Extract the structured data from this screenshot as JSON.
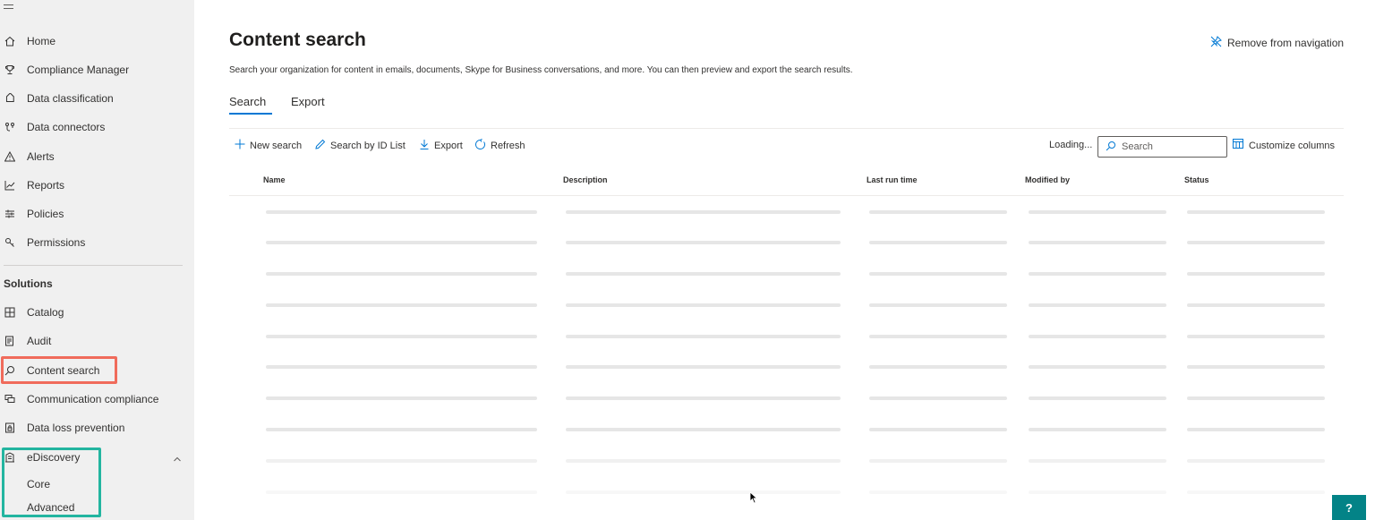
{
  "sidebar": {
    "items": [
      {
        "label": "Home",
        "icon": "home-icon"
      },
      {
        "label": "Compliance Manager",
        "icon": "trophy-icon"
      },
      {
        "label": "Data classification",
        "icon": "tag-icon"
      },
      {
        "label": "Data connectors",
        "icon": "connector-icon"
      },
      {
        "label": "Alerts",
        "icon": "warning-icon"
      },
      {
        "label": "Reports",
        "icon": "chart-icon"
      },
      {
        "label": "Policies",
        "icon": "sliders-icon"
      },
      {
        "label": "Permissions",
        "icon": "key-icon"
      }
    ],
    "section_title": "Solutions",
    "solutions": [
      {
        "label": "Catalog",
        "icon": "catalog-icon"
      },
      {
        "label": "Audit",
        "icon": "audit-icon"
      },
      {
        "label": "Content search",
        "icon": "search-icon"
      },
      {
        "label": "Communication compliance",
        "icon": "chat-icon"
      },
      {
        "label": "Data loss prevention",
        "icon": "lock-doc-icon"
      },
      {
        "label": "eDiscovery",
        "icon": "ediscovery-icon"
      }
    ],
    "ediscovery_sub": [
      "Core",
      "Advanced"
    ]
  },
  "header": {
    "title": "Content search",
    "subtitle": "Search your organization for content in emails, documents, Skype for Business conversations, and more. You can then preview and export the search results.",
    "remove_nav_label": "Remove from navigation"
  },
  "tabs": [
    {
      "label": "Search",
      "active": true
    },
    {
      "label": "Export",
      "active": false
    }
  ],
  "toolbar": {
    "new_search": "New search",
    "search_by_id": "Search by ID List",
    "export": "Export",
    "refresh": "Refresh",
    "loading": "Loading...",
    "search_placeholder": "Search",
    "customize_columns": "Customize columns"
  },
  "table": {
    "columns": [
      "Name",
      "Description",
      "Last run time",
      "Modified by",
      "Status"
    ]
  },
  "help": {
    "label": "?"
  },
  "colors": {
    "accent": "#0078d4",
    "highlight_red": "#f06b5b",
    "highlight_teal": "#23b5a0",
    "help_bg": "#038387"
  }
}
